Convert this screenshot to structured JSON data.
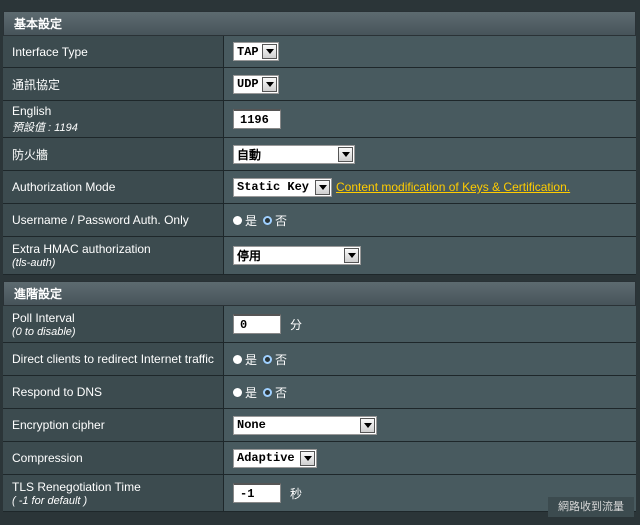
{
  "basic": {
    "header": "基本設定",
    "interface_type": {
      "label": "Interface Type",
      "value": "TAP"
    },
    "protocol": {
      "label": "通訊協定",
      "value": "UDP"
    },
    "port": {
      "label": "English",
      "sublabel": "預設值 : 1194",
      "value": "1196"
    },
    "firewall": {
      "label": "防火牆",
      "value": "自動"
    },
    "auth_mode": {
      "label": "Authorization Mode",
      "value": "Static Key",
      "link": "Content modification of Keys & Certification."
    },
    "username_auth": {
      "label": "Username / Password Auth. Only",
      "yes": "是",
      "no": "否",
      "selected": "yes"
    },
    "hmac": {
      "label": "Extra HMAC authorization",
      "sublabel": "(tls-auth)",
      "value": "停用"
    }
  },
  "advanced": {
    "header": "進階設定",
    "poll": {
      "label": "Poll Interval",
      "sublabel": "(0 to disable)",
      "value": "0",
      "unit": "分"
    },
    "redirect": {
      "label": "Direct clients to redirect Internet traffic",
      "yes": "是",
      "no": "否",
      "selected": "yes"
    },
    "dns": {
      "label": "Respond to DNS",
      "yes": "是",
      "no": "否",
      "selected": "yes"
    },
    "cipher": {
      "label": "Encryption cipher",
      "value": "None"
    },
    "compression": {
      "label": "Compression",
      "value": "Adaptive"
    },
    "tls_reneg": {
      "label": "TLS Renegotiation Time",
      "sublabel": "( -1 for default )",
      "value": "-1",
      "unit": "秒"
    }
  },
  "footer_button": "網路收到流量"
}
